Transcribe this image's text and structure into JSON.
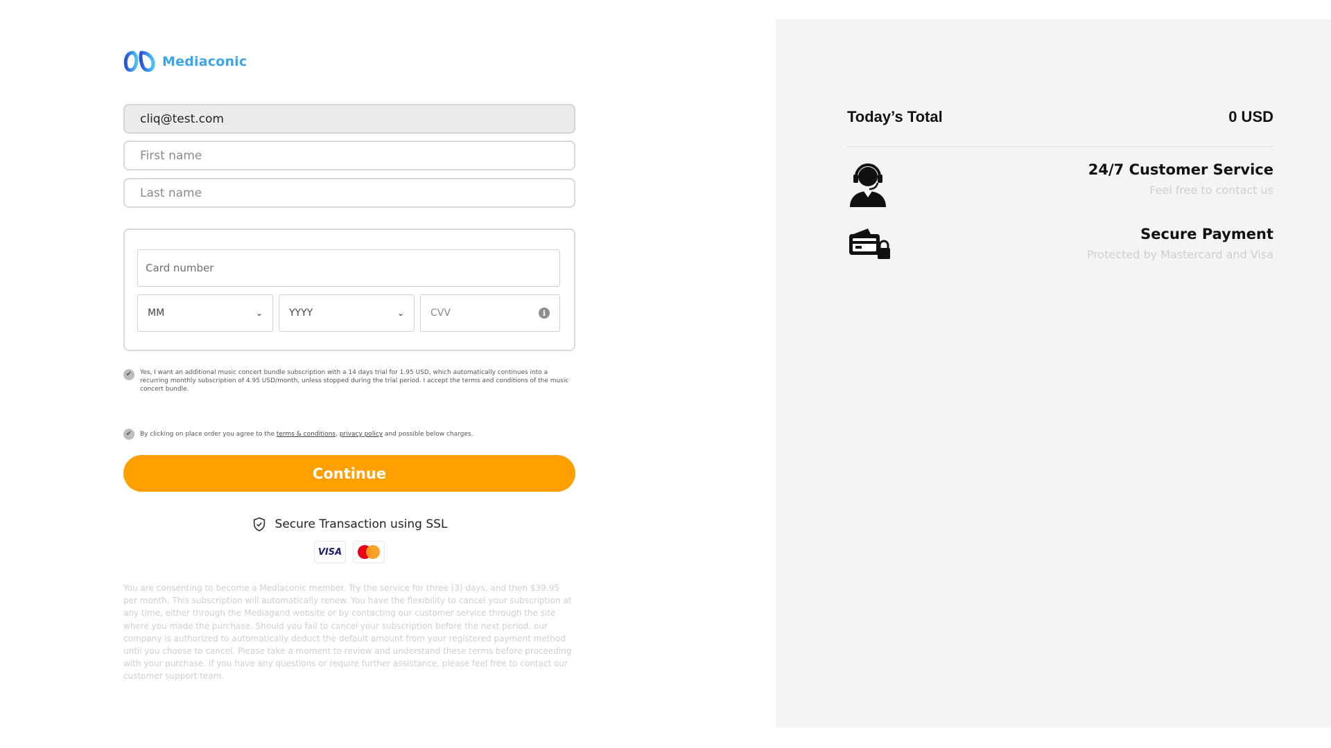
{
  "brand": {
    "name": "Mediaconic",
    "logo_color": "#3aa5ea"
  },
  "form": {
    "email": {
      "value": "cliq@test.com"
    },
    "first_name": {
      "placeholder": "First name",
      "value": ""
    },
    "last_name": {
      "placeholder": "Last name",
      "value": ""
    },
    "card": {
      "number_placeholder": "Card number",
      "month_select": "MM",
      "year_select": "YYYY",
      "cvv_placeholder": "CVV",
      "cvv_info_icon": "info-icon"
    },
    "consent_bundle": {
      "checked": true,
      "text": "Yes, I want an additional music concert bundle subscription with a 14 days trial for 1.95 USD, which automatically continues into a recurring monthly subscription of 4.95 USD/month, unless stopped during the trial period. I accept the terms and conditions of the music concert bundle."
    },
    "consent_terms": {
      "checked": true,
      "prefix": "By clicking on place order you agree to the ",
      "terms_link": "terms & conditions",
      "separator": ", ",
      "privacy_link": "privacy policy",
      "suffix": " and possible below charges."
    },
    "continue_label": "Continue",
    "continue_color": "#ffa000",
    "ssl_text": "Secure Transaction using SSL",
    "card_brands": [
      "VISA",
      "Mastercard"
    ],
    "legal_text": "You are consenting to become a Mediaconic member. Try the service for three (3) days, and then $39.95 per month. This subscription will automatically renew. You have the flexibility to cancel your subscription at any time, either through the Mediagand website or by contacting our customer service through the site where you made the purchase. Should you fail to cancel your subscription before the next period, our company is authorized to automatically deduct the default amount from your registered payment method until you choose to cancel. Please take a moment to review and understand these terms before proceeding with your purchase. If you have any questions or require further assistance, please feel free to contact our customer support team."
  },
  "summary": {
    "total_label": "Today’s Total",
    "total_value": "0 USD",
    "features": [
      {
        "icon": "headset-agent-icon",
        "title": "24/7 Customer Service",
        "subtitle": "Feel free to contact us"
      },
      {
        "icon": "credit-card-lock-icon",
        "title": "Secure Payment",
        "subtitle": "Protected by Mastercard and Visa"
      }
    ]
  }
}
